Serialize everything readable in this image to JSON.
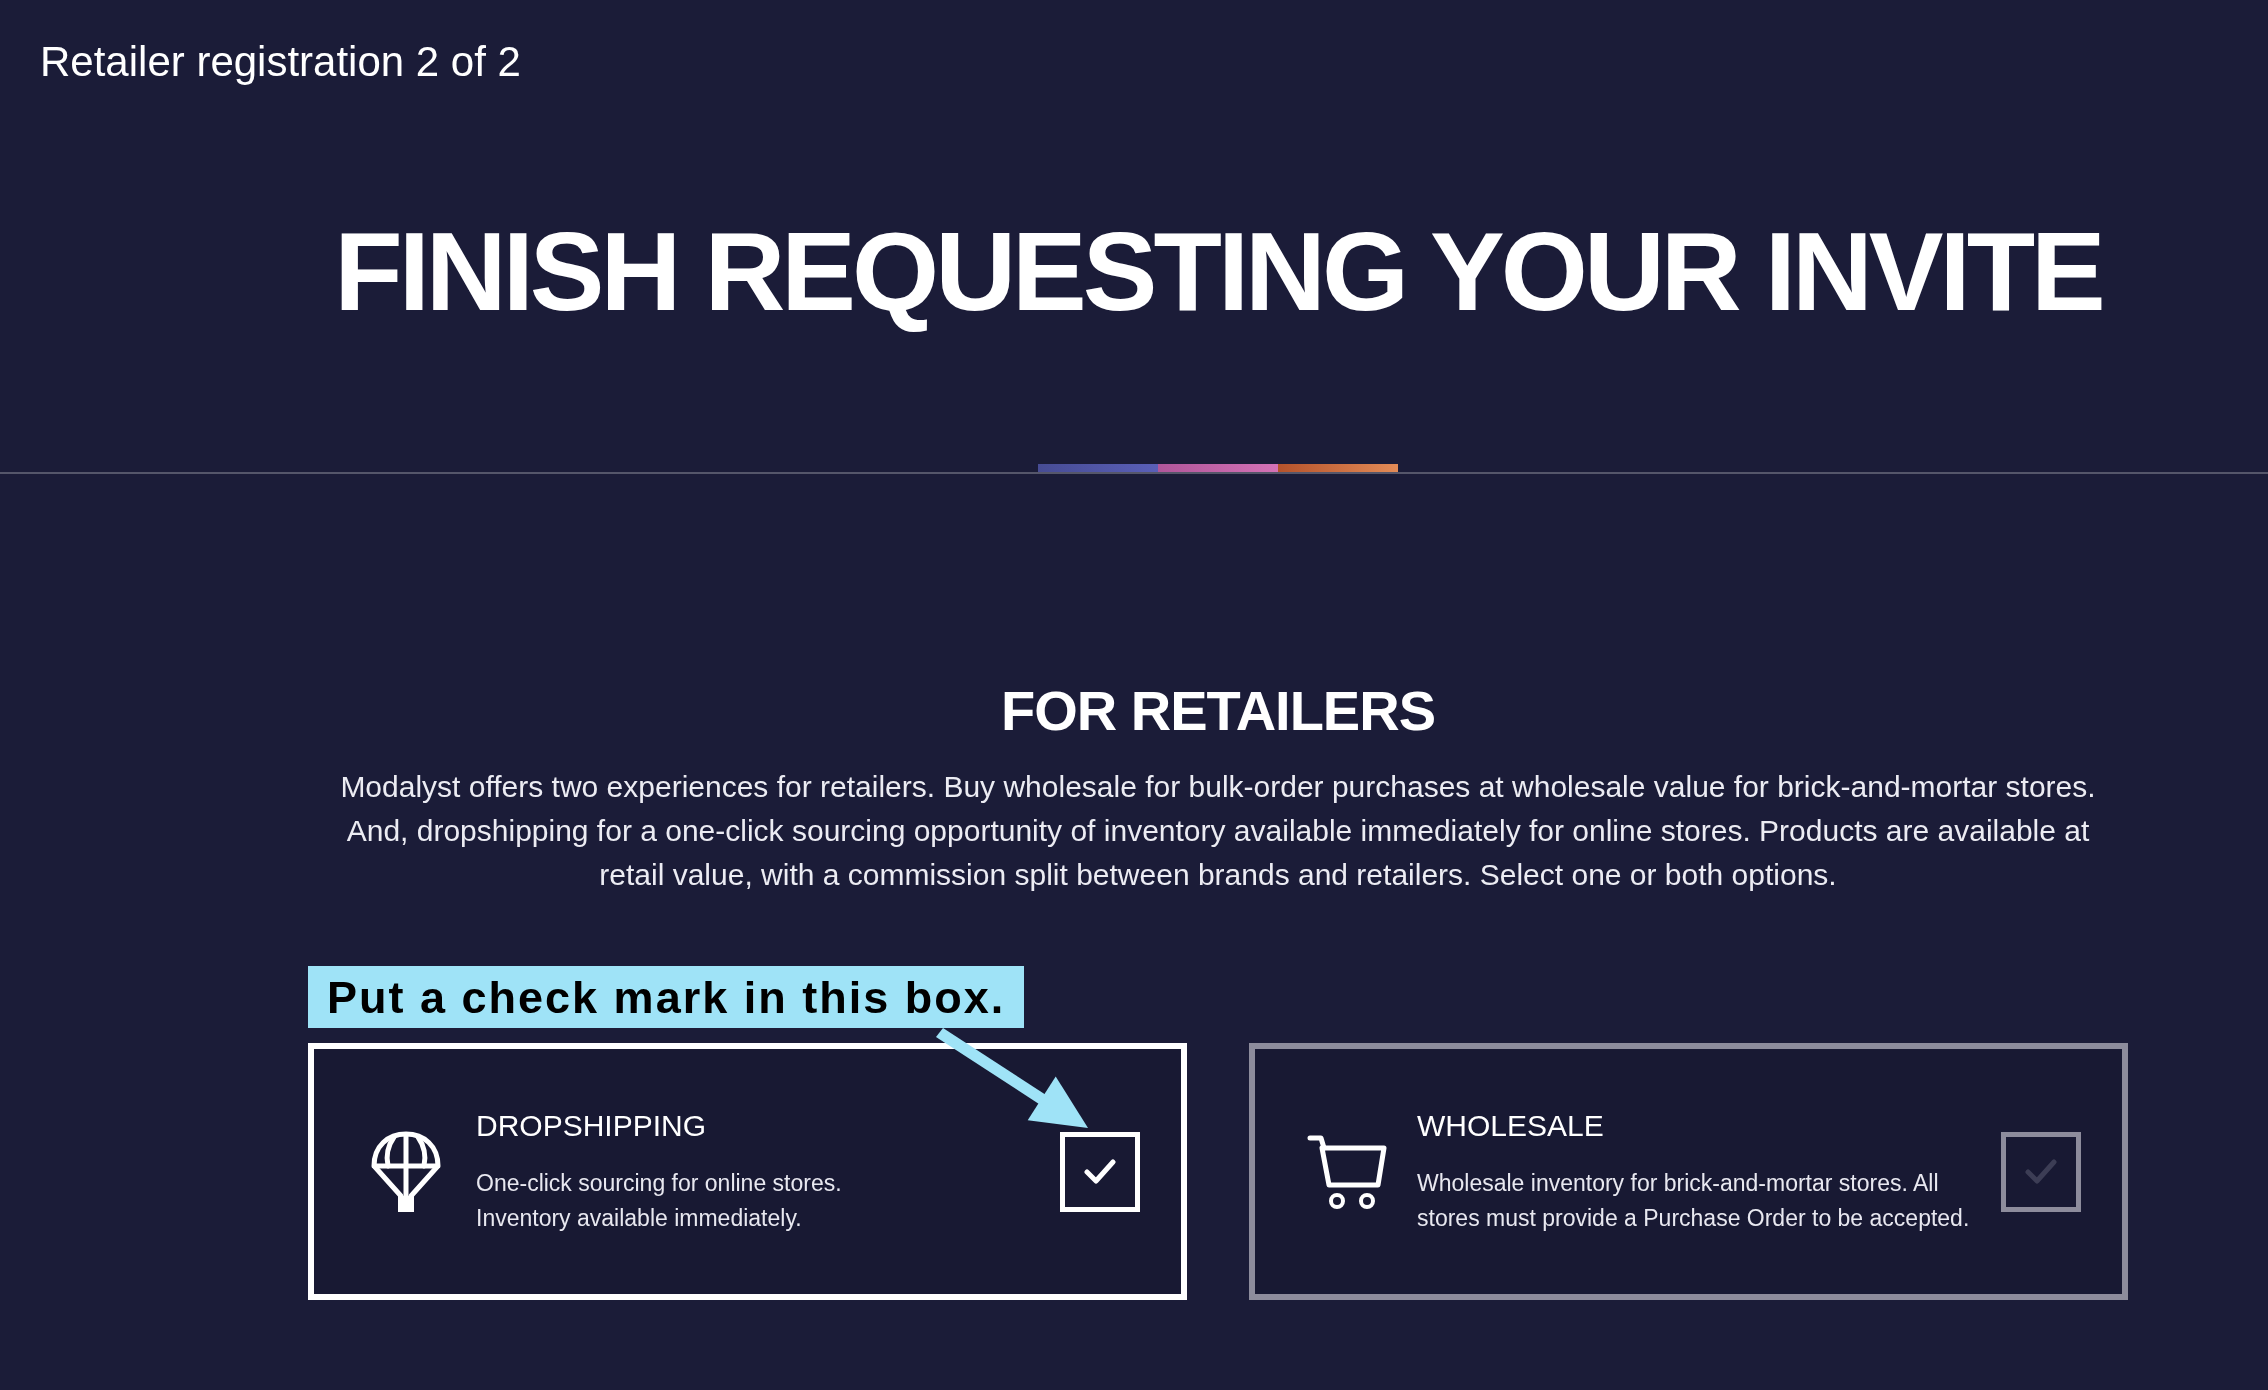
{
  "header": {
    "step_title": "Retailer registration 2 of 2"
  },
  "hero": {
    "title": "FINISH REQUESTING YOUR INVITE"
  },
  "section": {
    "title": "FOR RETAILERS",
    "description": "Modalyst offers two experiences for retailers. Buy wholesale for bulk-order purchases at wholesale value for brick-and-mortar stores. And, dropshipping for a one-click sourcing opportunity of inventory available immediately for online stores. Products are available at retail value, with a commission split between brands and retailers. Select one or both options."
  },
  "annotation": {
    "text": "Put a check mark in this box."
  },
  "options": [
    {
      "title": "DROPSHIPPING",
      "description_lines": [
        "One-click sourcing for online stores.",
        "Inventory available immediately."
      ],
      "checked": true
    },
    {
      "title": "WHOLESALE",
      "description_lines": [
        "Wholesale inventory for brick-and-mortar stores. All",
        "stores must provide a Purchase Order to be accepted."
      ],
      "checked": false
    }
  ]
}
